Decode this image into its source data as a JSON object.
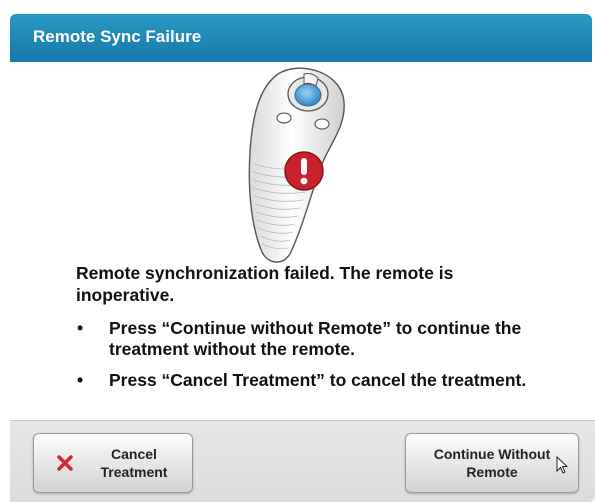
{
  "dialog": {
    "title": "Remote Sync Failure",
    "message": "Remote synchronization failed.  The remote is inoperative.",
    "bullets": [
      "Press “Continue without Remote” to continue the treatment without the remote.",
      "Press “Cancel Treatment” to cancel the treatment."
    ],
    "bullet_glyph": "•"
  },
  "buttons": {
    "cancel": {
      "line1": "Cancel",
      "line2": "Treatment",
      "icon": "close-x-icon"
    },
    "continue": {
      "line1": "Continue Without",
      "line2": "Remote"
    }
  },
  "icons": {
    "device": "remote-control-icon",
    "alert": "alert-exclamation-icon",
    "cursor": "mouse-cursor-icon"
  },
  "colors": {
    "titlebar": "#1f8bbb",
    "alert_red": "#c8232c",
    "cancel_x": "#d12a2a",
    "remote_button": "#4aa3de"
  }
}
